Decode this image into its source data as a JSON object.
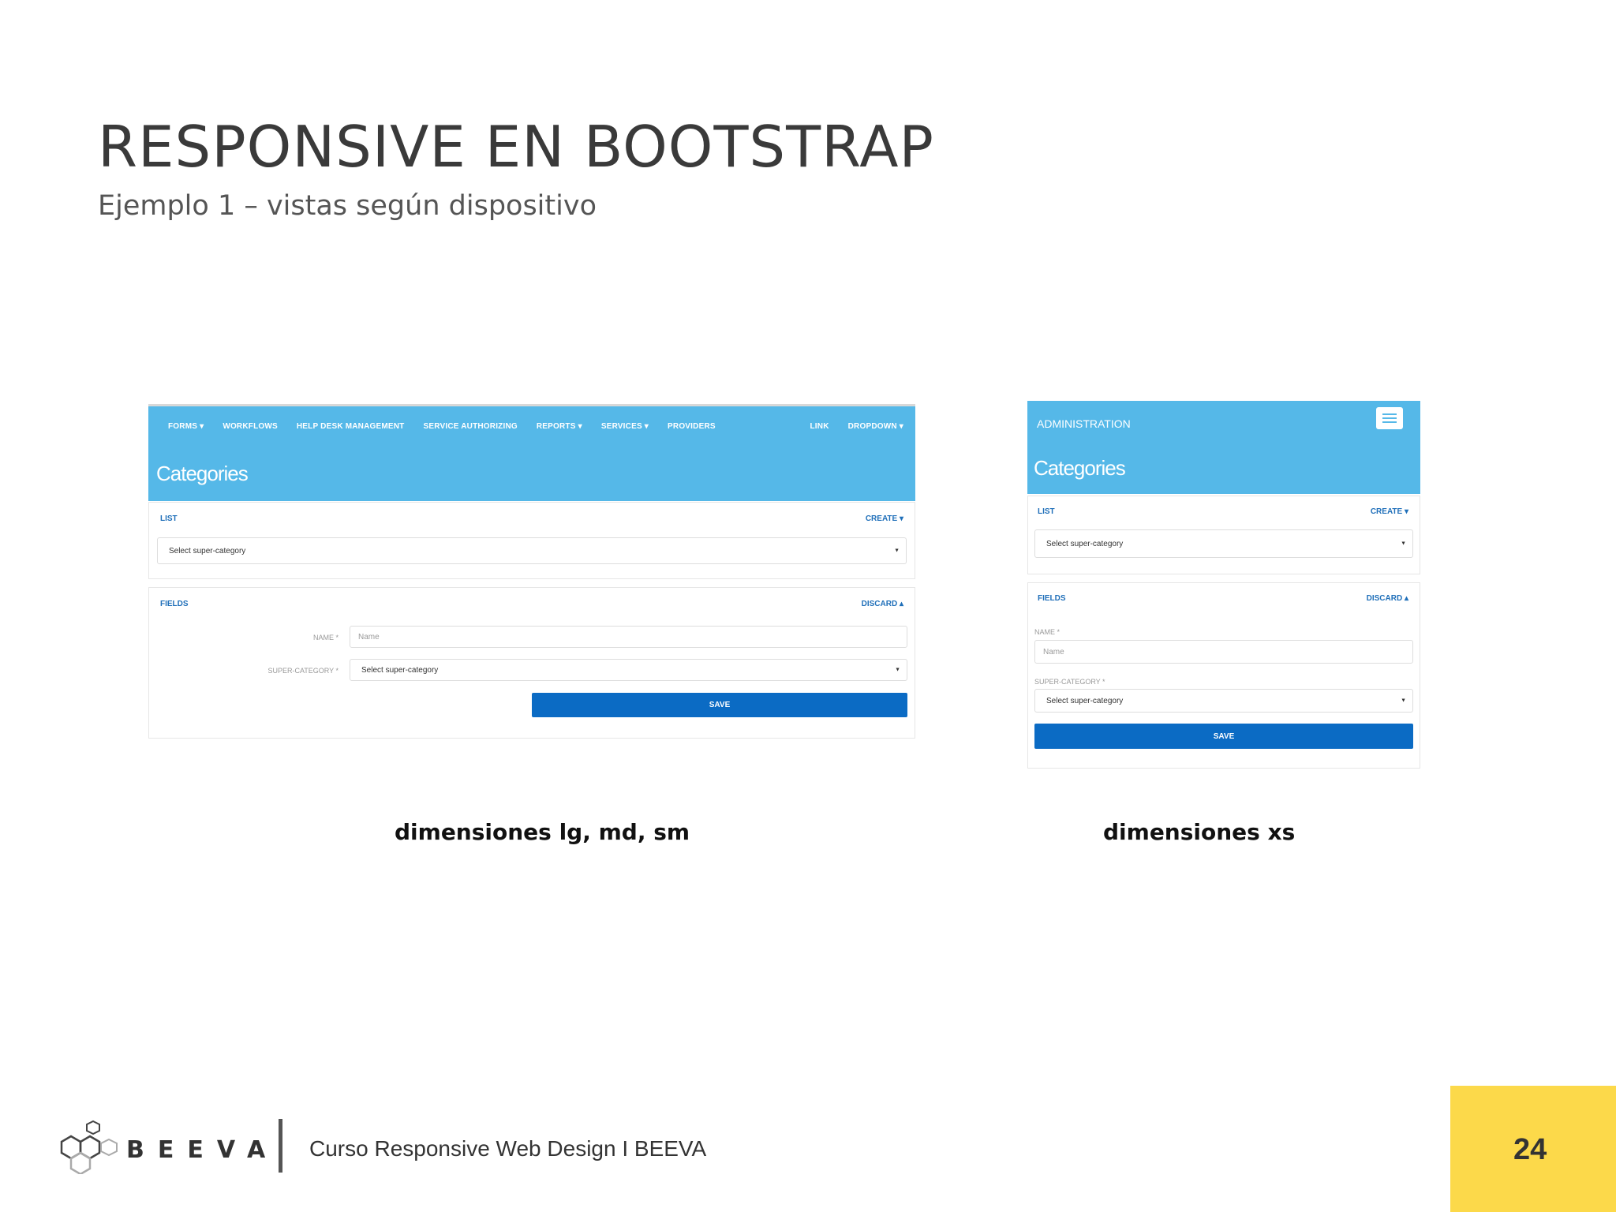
{
  "slide": {
    "title": "RESPONSIVE EN BOOTSTRAP",
    "subtitle": "Ejemplo 1 – vistas según dispositivo"
  },
  "mockup_lg": {
    "nav_items": [
      "FORMS ▾",
      "WORKFLOWS",
      "HELP DESK MANAGEMENT",
      "SERVICE AUTHORIZING",
      "REPORTS ▾",
      "SERVICES ▾",
      "PROVIDERS"
    ],
    "nav_right": [
      "LINK",
      "DROPDOWN ▾"
    ],
    "page_title": "Categories",
    "list_label": "LIST",
    "create_label": "CREATE ▾",
    "select_placeholder": "Select super-category",
    "fields_label": "FIELDS",
    "discard_label": "DISCARD ▴",
    "name_label": "NAME *",
    "name_placeholder": "Name",
    "supercat_label": "SUPER-CATEGORY *",
    "supercat_value": "Select super-category",
    "save_label": "SAVE",
    "caption": "dimensiones lg, md, sm"
  },
  "mockup_xs": {
    "brand": "ADMINISTRATION",
    "menu_icon": "hamburger-icon",
    "page_title": "Categories",
    "list_label": "LIST",
    "create_label": "CREATE ▾",
    "select_placeholder": "Select super-category",
    "fields_label": "FIELDS",
    "discard_label": "DISCARD ▴",
    "name_label": "NAME *",
    "name_placeholder": "Name",
    "supercat_label": "SUPER-CATEGORY *",
    "supercat_value": "Select super-category",
    "save_label": "SAVE",
    "caption": "dimensiones xs"
  },
  "footer": {
    "brand": "BEEVA",
    "course": "Curso Responsive Web Design I BEEVA",
    "page_number": "24",
    "accent_color": "#fcd94a"
  },
  "colors": {
    "header_blue": "#55b8e8",
    "link_blue": "#1f6fb9",
    "button_blue": "#0b6bc4"
  }
}
